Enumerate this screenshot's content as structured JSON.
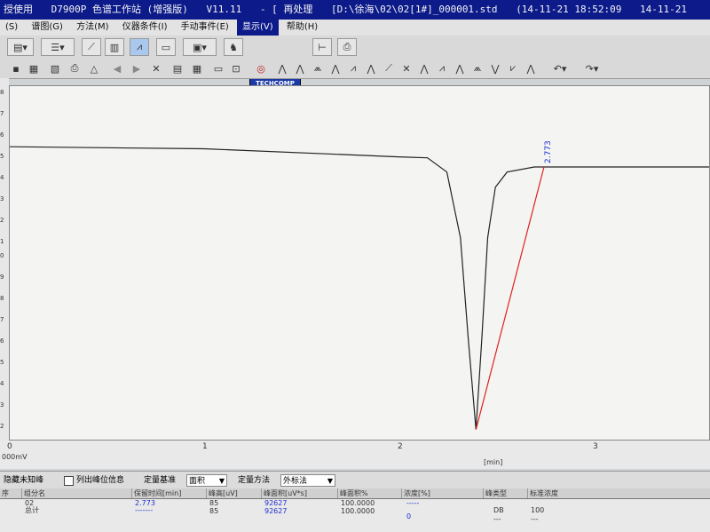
{
  "window": {
    "title_parts": [
      "授使用",
      "D7900P 色谱工作站 (增强版)",
      "V11.11",
      "- [ 再处理",
      "[D:\\徐海\\02\\02[1#]_000001.std",
      "(14-11-21 18:52:09",
      "14-11-21"
    ]
  },
  "menu": {
    "items": [
      "(S)",
      "谱图(G)",
      "方法(M)",
      "仪器条件(I)",
      "手动事件(E)",
      "显示(V)",
      "帮助(H)"
    ],
    "active_index": 5
  },
  "toolbar": {
    "techcomp_label": "TECHCOMP"
  },
  "chromatogram": {
    "y_ticks": [
      "8",
      "7",
      "6",
      "5",
      "4",
      "3",
      "2",
      "1",
      "0",
      "9",
      "8",
      "7",
      "6",
      "5",
      "4",
      "3",
      "2"
    ],
    "x_ticks": [
      "0",
      "1",
      "2",
      "3"
    ],
    "x_unit": "[min]",
    "y_unit": "000mV",
    "peak_label": "2.773",
    "trace_color": "#222222",
    "baseline_color": "#e02020",
    "label_color": "#1d2fd0"
  },
  "chart_data": {
    "type": "line",
    "x_range": [
      0,
      3.6
    ],
    "series": [
      {
        "x": [
          0,
          1.0,
          2.0,
          2.15,
          2.25,
          2.32,
          2.36,
          2.4,
          2.43,
          2.46,
          2.5,
          2.56,
          2.7,
          3.0,
          3.6
        ],
        "y": [
          0.3,
          0.28,
          0.2,
          0.19,
          0.05,
          -0.6,
          -1.6,
          -2.5,
          -1.6,
          -0.6,
          -0.1,
          0.05,
          0.1,
          0.1,
          0.1
        ]
      }
    ],
    "baseline_segment": {
      "x": [
        2.4,
        2.75
      ],
      "y": [
        -2.5,
        0.1
      ]
    },
    "y_range": [
      -2.6,
      0.9
    ],
    "annotations": [
      {
        "x": 2.773,
        "text": "2.773"
      }
    ]
  },
  "controls": {
    "hide_unknown_peaks": "隐藏未知峰",
    "list_peak_info": "列出峰位信息",
    "quant_basis_label": "定量基准",
    "quant_basis_value": "面积",
    "quant_method_label": "定量方法",
    "quant_method_value": "外标法"
  },
  "table": {
    "headers": [
      "序",
      "组分名",
      "保留时间[min]",
      "峰高[uV]",
      "峰面积[uV*s]",
      "峰面积%",
      "浓度[%]",
      "峰类型",
      "标准浓度"
    ],
    "rows": [
      {
        "seq": "",
        "name": "02",
        "rt": "2.773",
        "height": "85",
        "area": "92627",
        "area_pct": "100.0000",
        "conc": "-----",
        "type": "DB",
        "std": "100"
      },
      {
        "seq": "",
        "name": "总计",
        "rt": "-------",
        "height": "85",
        "area": "92627",
        "area_pct": "100.0000",
        "conc": "0",
        "type": "---",
        "std": "---"
      }
    ]
  }
}
